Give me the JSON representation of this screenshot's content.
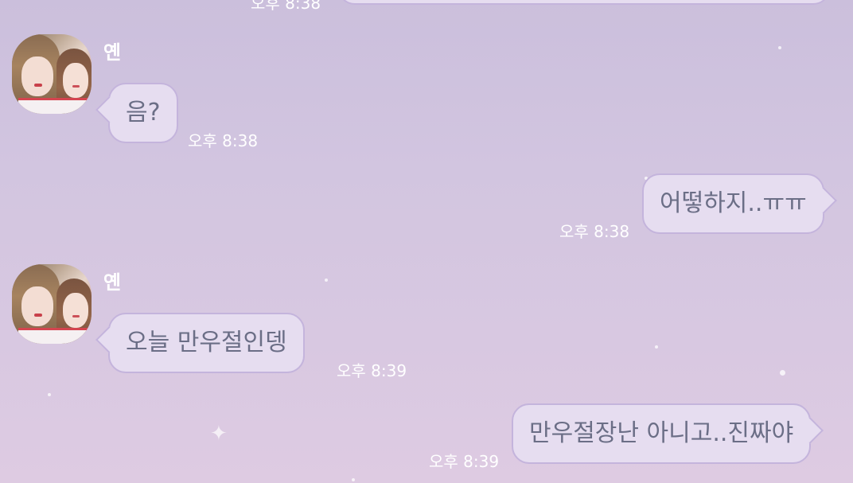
{
  "chat": {
    "messages": [
      {
        "side": "top",
        "time": "오후 8:38"
      },
      {
        "side": "left",
        "sender": "옌",
        "text": "음?",
        "time": "오후 8:38"
      },
      {
        "side": "right",
        "text": "어떻하지..ㅠㅠ",
        "time": "오후 8:38"
      },
      {
        "side": "left",
        "sender": "옌",
        "text": "오늘 만우절인뎅",
        "time": "오후 8:39"
      },
      {
        "side": "right",
        "text": "만우절장난 아니고..진짜야",
        "time": "오후 8:39"
      }
    ]
  },
  "icons": {
    "avatar": "profile-photo-two-girls"
  },
  "colors": {
    "background_top": "#cbbfdc",
    "background_bottom": "#decbe2",
    "bubble_fill": "#e6ddf0",
    "bubble_border": "#c4b4dc",
    "bubble_text": "#6b6e86",
    "meta_text": "#ffffff"
  }
}
